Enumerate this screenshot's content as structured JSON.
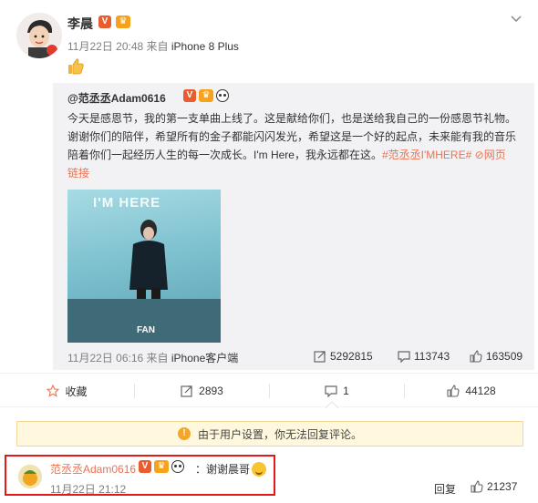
{
  "post": {
    "author": "李晨",
    "timestamp": "11月22日 20:48",
    "source_prefix": "来自",
    "device": "iPhone 8 Plus",
    "content_emoji": "thumbs-up"
  },
  "retweet": {
    "author": "@范丞丞Adam0616",
    "line1": "今天是感恩节，我的第一支单曲上线了。这是献给你们，也是送给我自己的一份感恩节礼物。",
    "line2": "谢谢你们的陪伴，希望所有的金子都能闪闪发光，希望这是一个好的起点，未来能有我的音乐",
    "line3_text": "陪着你们一起经历人生的每一次成长。I'm Here，我永远都在这。",
    "hashtag": "#范丞丞I'MHERE#",
    "web_link": "网页",
    "line4": "链接",
    "image_title": "I'M HERE",
    "image_caption": "FAN",
    "timestamp": "11月22日 06:16",
    "source_prefix": "来自",
    "device": "iPhone客户端",
    "reposts": "5292815",
    "comments": "113743",
    "likes": "163509"
  },
  "actions": {
    "favorite": "收藏",
    "repost": "2893",
    "comment": "1",
    "like": "44128"
  },
  "notice": "由于用户设置，你无法回复评论。",
  "comment": {
    "author": "范丞丞Adam0616",
    "text": "：谢谢晨哥",
    "time": "11月22日 21:12",
    "reply": "回复",
    "likes": "21237"
  },
  "colors": {
    "accent": "#eb7350",
    "highlight_frame": "#e31818",
    "notice_bg": "#fff8df"
  }
}
